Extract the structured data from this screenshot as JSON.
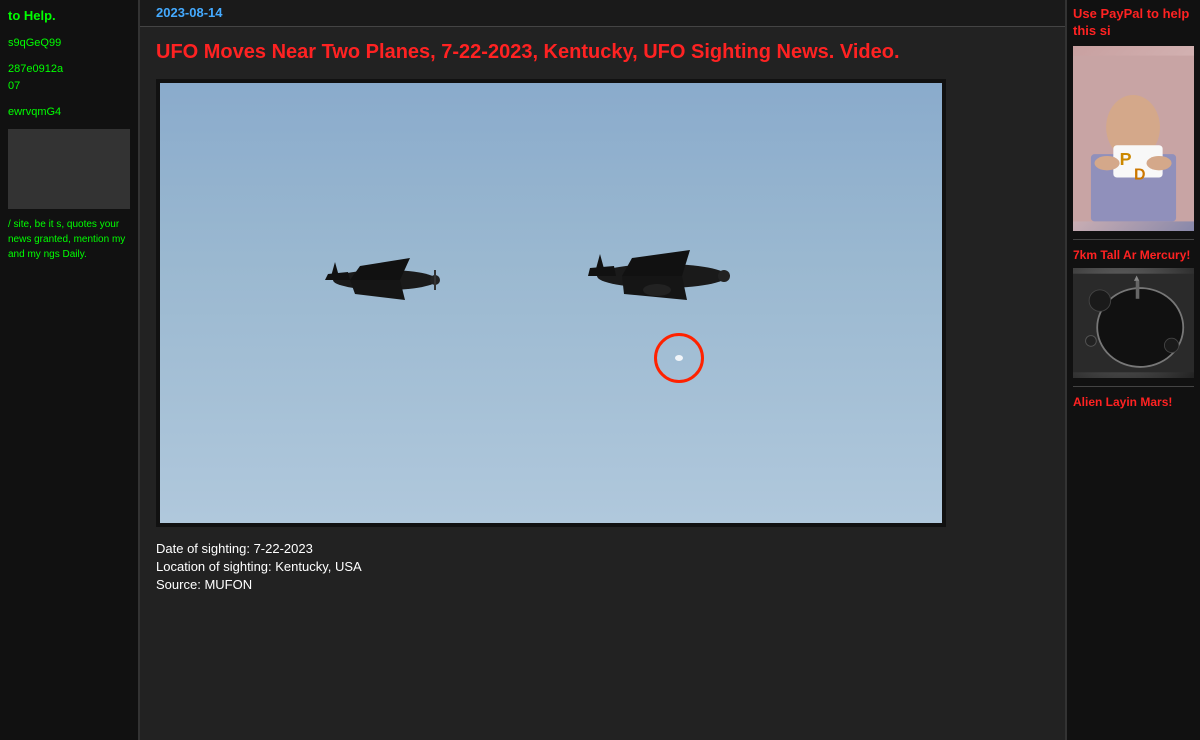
{
  "sidebar_left": {
    "help_text": "to Help.",
    "code1": "s9qGeQ99",
    "code2": "287e0912a",
    "code3": "07",
    "code4": "ewrvqmG4",
    "permission_text": "/ site, be it s, quotes your news granted, mention my and my ngs Daily."
  },
  "main": {
    "date": "2023-08-14",
    "article_title": "UFO Moves Near Two Planes, 7-22-2023, Kentucky, UFO Sighting News. Video.",
    "date_of_sighting_label": "Date of sighting:",
    "date_of_sighting_value": "7-22-2023",
    "location_label": "Location of sighting:",
    "location_value": "Kentucky, USA",
    "source_label": "Source:",
    "source_value": "MUFON"
  },
  "sidebar_right": {
    "paypal_title": "Use PayPal to help this si",
    "paypal_card_line1": "P",
    "paypal_card_line2": "D",
    "mercury_title": "7km Tall Ar Mercury!",
    "alien_title": "Alien Layin Mars!"
  }
}
